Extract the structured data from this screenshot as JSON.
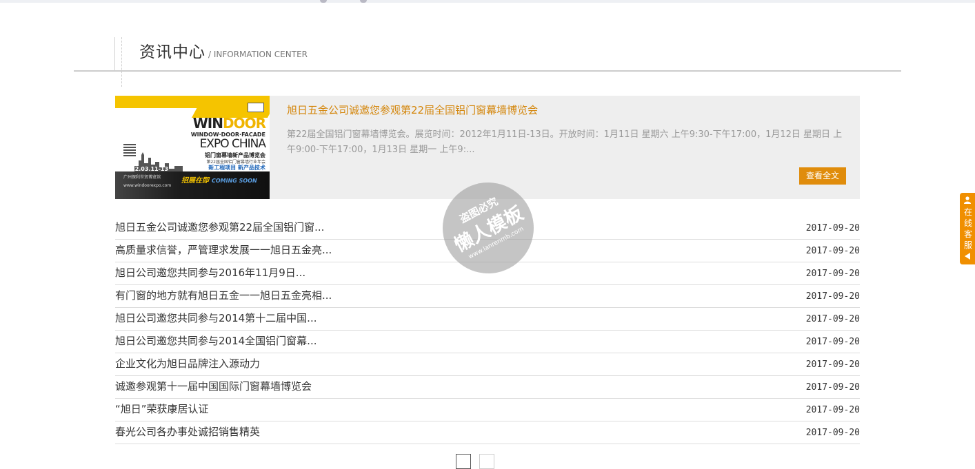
{
  "header": {
    "title": "资讯中心",
    "subtitle": "/ INFORMATION CENTER"
  },
  "featured": {
    "title": "旭日五金公司诚邀您参观第22届全国铝门窗幕墙博览会",
    "description": "第22届全国铝门窗幕墙博览会。展览时间：2012年1月11日-13日。开放时间：1月11日 星期六 上午9:30-下午17:00，1月12日 星期日 上午9:00-下午17:00，1月13日 星期一 上午9:...",
    "more_label": "查看全文",
    "poster": {
      "line1a": "WIN",
      "line1b": "DOOR",
      "line2": "WINDOW·DOOR·FACADE",
      "line3": "EXPO CHINA",
      "line4": "铝门窗幕墙新产品博览会",
      "line5": "第22届全国铝门窗幕墙行业年会",
      "line6": "新工程项目 新产品技术",
      "date": "2012.03.11-13",
      "place": "广州保利世贸博览馆",
      "url": "www.windoorexpo.com",
      "band_text": "招展在即",
      "band_sub": "COMING SOON"
    }
  },
  "news": [
    {
      "title": "旭日五金公司诚邀您参观第22届全国铝门窗...",
      "date": "2017-09-20"
    },
    {
      "title": "高质量求信誉，严管理求发展一一旭日五金亮...",
      "date": "2017-09-20"
    },
    {
      "title": "旭日公司邀您共同参与2016年11月9日...",
      "date": "2017-09-20"
    },
    {
      "title": "有门窗的地方就有旭日五金一一旭日五金亮相...",
      "date": "2017-09-20"
    },
    {
      "title": "旭日公司邀您共同参与2014第十二届中国...",
      "date": "2017-09-20"
    },
    {
      "title": "旭日公司邀您共同参与2014全国铝门窗幕...",
      "date": "2017-09-20"
    },
    {
      "title": "企业文化为旭日品牌注入源动力",
      "date": "2017-09-20"
    },
    {
      "title": "诚邀参观第十一届中国国际门窗幕墙博览会",
      "date": "2017-09-20"
    },
    {
      "title": "“旭日”荣获康居认证",
      "date": "2017-09-20"
    },
    {
      "title": "春光公司各办事处诚招销售精英",
      "date": "2017-09-20"
    }
  ],
  "watermark": {
    "line1": "盗图必究",
    "line2": "懒人模板",
    "line3": "www.lanrenmb.com"
  },
  "kefu": {
    "label": "在线客服"
  },
  "colors": {
    "accent": "#e08c0b",
    "title_orange": "#d4860b",
    "kefu_orange": "#f08f00"
  },
  "icons": [
    "user-icon",
    "arrow-left-icon"
  ]
}
